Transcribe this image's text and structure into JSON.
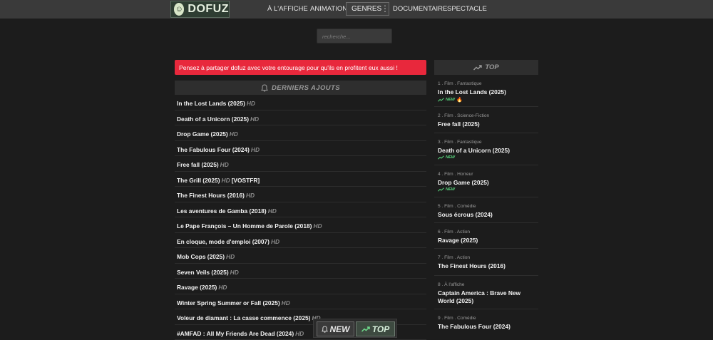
{
  "header": {
    "logo_text": "DOFUZ",
    "nav": [
      {
        "label": "À L'AFFICHE"
      },
      {
        "label": "ANIMATION"
      },
      {
        "label": "GENRES"
      },
      {
        "label": "DOCUMENTAIRE"
      },
      {
        "label": "SPECTACLE"
      }
    ]
  },
  "search": {
    "placeholder": "recherche..."
  },
  "alert": {
    "text": "Pensez à partager dofuz avec votre entourage pour qu'ils en profitent eux aussi !"
  },
  "latest": {
    "title": "DERNIERS AJOUTS",
    "items": [
      {
        "title": "In the Lost Lands (2025)",
        "quality": "HD",
        "extra": ""
      },
      {
        "title": "Death of a Unicorn (2025)",
        "quality": "HD",
        "extra": ""
      },
      {
        "title": "Drop Game (2025)",
        "quality": "HD",
        "extra": ""
      },
      {
        "title": "The Fabulous Four (2024)",
        "quality": "HD",
        "extra": ""
      },
      {
        "title": "Free fall (2025)",
        "quality": "HD",
        "extra": ""
      },
      {
        "title": "The Grill (2025)",
        "quality": "HD",
        "extra": "[VOSTFR]"
      },
      {
        "title": "The Finest Hours (2016)",
        "quality": "HD",
        "extra": ""
      },
      {
        "title": "Les aventures de Gamba (2018)",
        "quality": "HD",
        "extra": ""
      },
      {
        "title": "Le Pape François – Un Homme de Parole (2018)",
        "quality": "HD",
        "extra": ""
      },
      {
        "title": "En cloque, mode d'emploi (2007)",
        "quality": "HD",
        "extra": ""
      },
      {
        "title": "Mob Cops (2025)",
        "quality": "HD",
        "extra": ""
      },
      {
        "title": "Seven Veils (2025)",
        "quality": "HD",
        "extra": ""
      },
      {
        "title": "Ravage (2025)",
        "quality": "HD",
        "extra": ""
      },
      {
        "title": "Winter Spring Summer or Fall (2025)",
        "quality": "HD",
        "extra": ""
      },
      {
        "title": "Voleur de diamant : La casse commence (2025)",
        "quality": "HD",
        "extra": ""
      },
      {
        "title": "#AMFAD : All My Friends Are Dead (2024)",
        "quality": "HD",
        "extra": ""
      }
    ]
  },
  "top": {
    "title": "TOP",
    "items": [
      {
        "meta": "1 . Film . Fantastique",
        "title": "In the Lost Lands (2025)",
        "badge": "NEW",
        "fire": "🔥"
      },
      {
        "meta": "2 . Film . Science-Fiction",
        "title": "Free fall (2025)",
        "badge": "",
        "fire": ""
      },
      {
        "meta": "3 . Film . Fantastique",
        "title": "Death of a Unicorn (2025)",
        "badge": "NEW",
        "fire": ""
      },
      {
        "meta": "4 . Film . Horreur",
        "title": "Drop Game (2025)",
        "badge": "NEW",
        "fire": ""
      },
      {
        "meta": "5 . Film . Comédie",
        "title": "Sous écrous (2024)",
        "badge": "",
        "fire": ""
      },
      {
        "meta": "6 . Film . Action",
        "title": "Ravage (2025)",
        "badge": "",
        "fire": ""
      },
      {
        "meta": "7 . Film . Action",
        "title": "The Finest Hours (2016)",
        "badge": "",
        "fire": ""
      },
      {
        "meta": "8 . À l'affiche",
        "title": "Captain America : Brave New World (2025)",
        "badge": "",
        "fire": ""
      },
      {
        "meta": "9 . Film . Comédie",
        "title": "The Fabulous Four (2024)",
        "badge": "",
        "fire": ""
      }
    ]
  },
  "bottom_tabs": {
    "new_label": "NEW",
    "top_label": "TOP"
  }
}
